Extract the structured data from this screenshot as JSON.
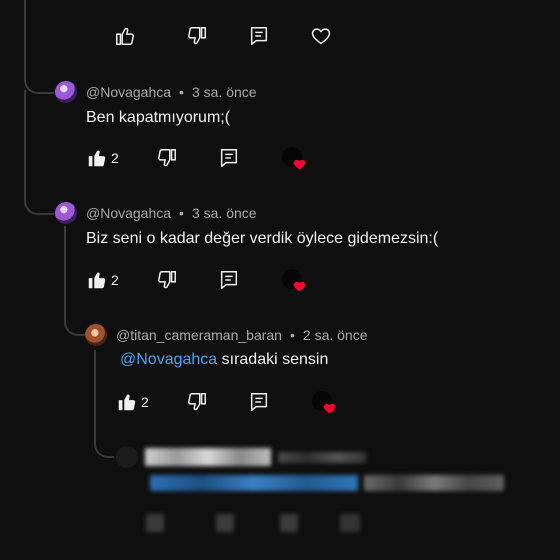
{
  "top_actions": {
    "like_icon": "thumbs-up-outline",
    "dislike_icon": "thumbs-down-outline",
    "reply_icon": "comment",
    "heart_icon": "heart-outline"
  },
  "comments": [
    {
      "author": "@Novagahca",
      "separator": "•",
      "time": "3 sa. önce",
      "text": "Ben kapatmıyorum;(",
      "like_count": "2"
    },
    {
      "author": "@Novagahca",
      "separator": "•",
      "time": "3 sa. önce",
      "text": "Biz seni o kadar değer verdik öylece gidemezsin:(",
      "like_count": "2"
    },
    {
      "author": "@titan_cameraman_baran",
      "separator": "•",
      "time": "2 sa. önce",
      "mention": "@Novagahca",
      "text": " sıradaki sensin",
      "like_count": "2"
    }
  ],
  "colors": {
    "background": "#0f0f0f",
    "text": "#f1f1f1",
    "meta": "#aaaaaa",
    "mention": "#3ea6ff",
    "heart": "#ff0033",
    "thread": "#3a3a3a"
  }
}
